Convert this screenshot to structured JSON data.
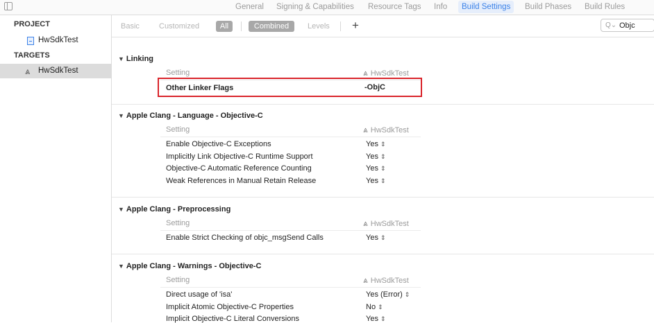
{
  "tabs": [
    "General",
    "Signing & Capabilities",
    "Resource Tags",
    "Info",
    "Build Settings",
    "Build Phases",
    "Build Rules"
  ],
  "active_tab": "Build Settings",
  "navigator": {
    "project_header": "PROJECT",
    "project_item": "HwSdkTest",
    "targets_header": "TARGETS",
    "target_item": "HwSdkTest"
  },
  "filter": {
    "basic": "Basic",
    "customized": "Customized",
    "all": "All",
    "combined": "Combined",
    "levels": "Levels",
    "add": "+"
  },
  "search": {
    "value": "Objc",
    "icon": "search-icon"
  },
  "sections": {
    "linking": {
      "title": "Linking",
      "col_setting": "Setting",
      "col_target": "HwSdkTest",
      "rows": [
        {
          "name": "Other Linker Flags",
          "value": "-ObjC"
        }
      ]
    },
    "language": {
      "title": "Apple Clang - Language - Objective-C",
      "col_setting": "Setting",
      "col_target": "HwSdkTest",
      "rows": [
        {
          "name": "Enable Objective-C Exceptions",
          "value": "Yes"
        },
        {
          "name": "Implicitly Link Objective-C Runtime Support",
          "value": "Yes"
        },
        {
          "name": "Objective-C Automatic Reference Counting",
          "value": "Yes"
        },
        {
          "name": "Weak References in Manual Retain Release",
          "value": "Yes"
        }
      ]
    },
    "preprocessing": {
      "title": "Apple Clang - Preprocessing",
      "col_setting": "Setting",
      "col_target": "HwSdkTest",
      "rows": [
        {
          "name": "Enable Strict Checking of objc_msgSend Calls",
          "value": "Yes"
        }
      ]
    },
    "warnings": {
      "title": "Apple Clang - Warnings - Objective-C",
      "col_setting": "Setting",
      "col_target": "HwSdkTest",
      "rows": [
        {
          "name": "Direct usage of 'isa'",
          "value": "Yes (Error)"
        },
        {
          "name": "Implicit Atomic Objective-C Properties",
          "value": "No"
        },
        {
          "name": "Implicit Objective-C Literal Conversions",
          "value": "Yes"
        }
      ]
    }
  },
  "colors": {
    "accent": "#3b82e8",
    "highlight_border": "#d9232a"
  }
}
